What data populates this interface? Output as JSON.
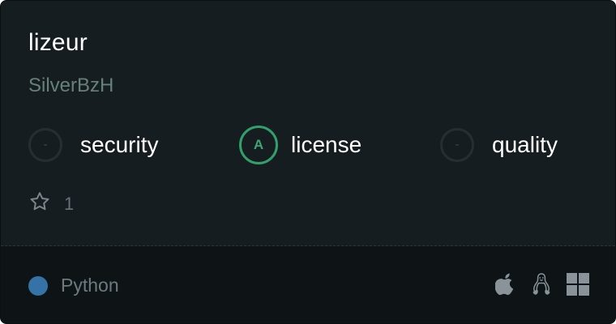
{
  "repo": {
    "name": "lizeur",
    "owner": "SilverBzH",
    "stars": "1"
  },
  "scores": [
    {
      "label": "security",
      "grade": "-",
      "color": "#3a4349"
    },
    {
      "label": "license",
      "grade": "A",
      "color": "#32a06a"
    },
    {
      "label": "quality",
      "grade": "-",
      "color": "#3a4349"
    }
  ],
  "language": {
    "name": "Python",
    "color": "#3572a5"
  },
  "platforms": [
    "apple-icon",
    "linux-icon",
    "windows-icon"
  ],
  "icons": {
    "star": "star-icon"
  }
}
